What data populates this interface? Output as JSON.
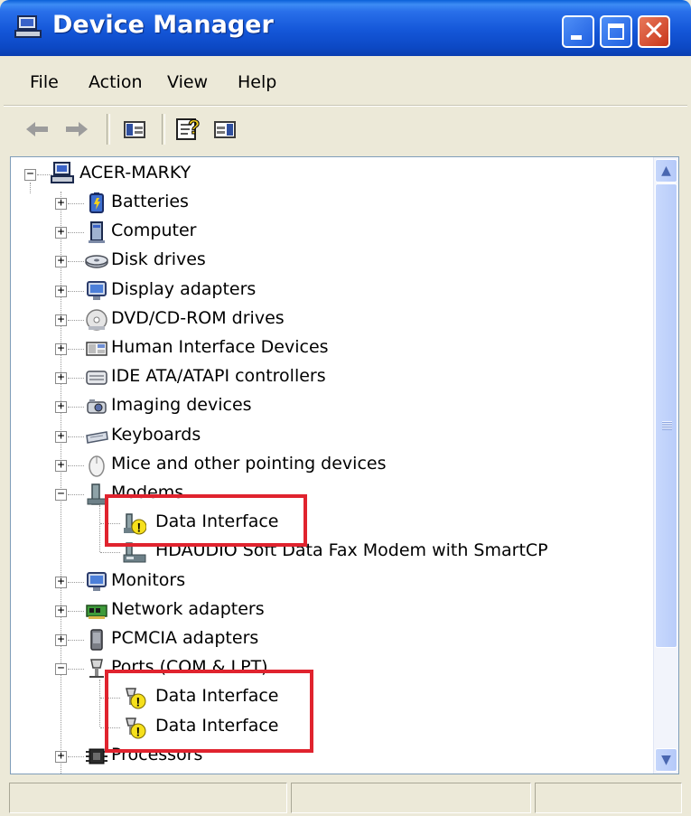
{
  "window": {
    "title": "Device Manager"
  },
  "menu": {
    "items": [
      "File",
      "Action",
      "View",
      "Help"
    ]
  },
  "toolbar": {
    "buttons": [
      "back-icon",
      "forward-icon",
      "show-hide-console-tree-icon",
      "help-icon",
      "show-hide-action-pane-icon"
    ]
  },
  "tree": {
    "root": "ACER-MARKY",
    "items": [
      {
        "label": "Batteries",
        "icon": "battery-icon",
        "expanded": false
      },
      {
        "label": "Computer",
        "icon": "computer-icon",
        "expanded": false
      },
      {
        "label": "Disk drives",
        "icon": "disk-drive-icon",
        "expanded": false
      },
      {
        "label": "Display adapters",
        "icon": "monitor-icon",
        "expanded": false
      },
      {
        "label": "DVD/CD-ROM drives",
        "icon": "cdrom-icon",
        "expanded": false
      },
      {
        "label": "Human Interface Devices",
        "icon": "hid-icon",
        "expanded": false
      },
      {
        "label": "IDE ATA/ATAPI controllers",
        "icon": "ide-controller-icon",
        "expanded": false
      },
      {
        "label": "Imaging devices",
        "icon": "camera-icon",
        "expanded": false
      },
      {
        "label": "Keyboards",
        "icon": "keyboard-icon",
        "expanded": false
      },
      {
        "label": "Mice and other pointing devices",
        "icon": "mouse-icon",
        "expanded": false
      },
      {
        "label": "Modems",
        "icon": "modem-icon",
        "expanded": true,
        "children": [
          {
            "label": "Data Interface",
            "icon": "warning-device-icon"
          },
          {
            "label": "HDAUDIO Soft Data Fax Modem with SmartCP",
            "icon": "modem-device-icon"
          }
        ]
      },
      {
        "label": "Monitors",
        "icon": "monitor-icon",
        "expanded": false
      },
      {
        "label": "Network adapters",
        "icon": "network-card-icon",
        "expanded": false
      },
      {
        "label": "PCMCIA adapters",
        "icon": "pcmcia-icon",
        "expanded": false
      },
      {
        "label": "Ports (COM & LPT)",
        "icon": "port-icon",
        "expanded": true,
        "children": [
          {
            "label": "Data Interface",
            "icon": "warning-port-icon"
          },
          {
            "label": "Data Interface",
            "icon": "warning-port-icon"
          }
        ]
      },
      {
        "label": "Processors",
        "icon": "processor-icon",
        "expanded": false
      }
    ]
  },
  "colors": {
    "titlebar": "#0c48c4",
    "highlight": "#e0232e",
    "warning": "#f6e01c"
  }
}
